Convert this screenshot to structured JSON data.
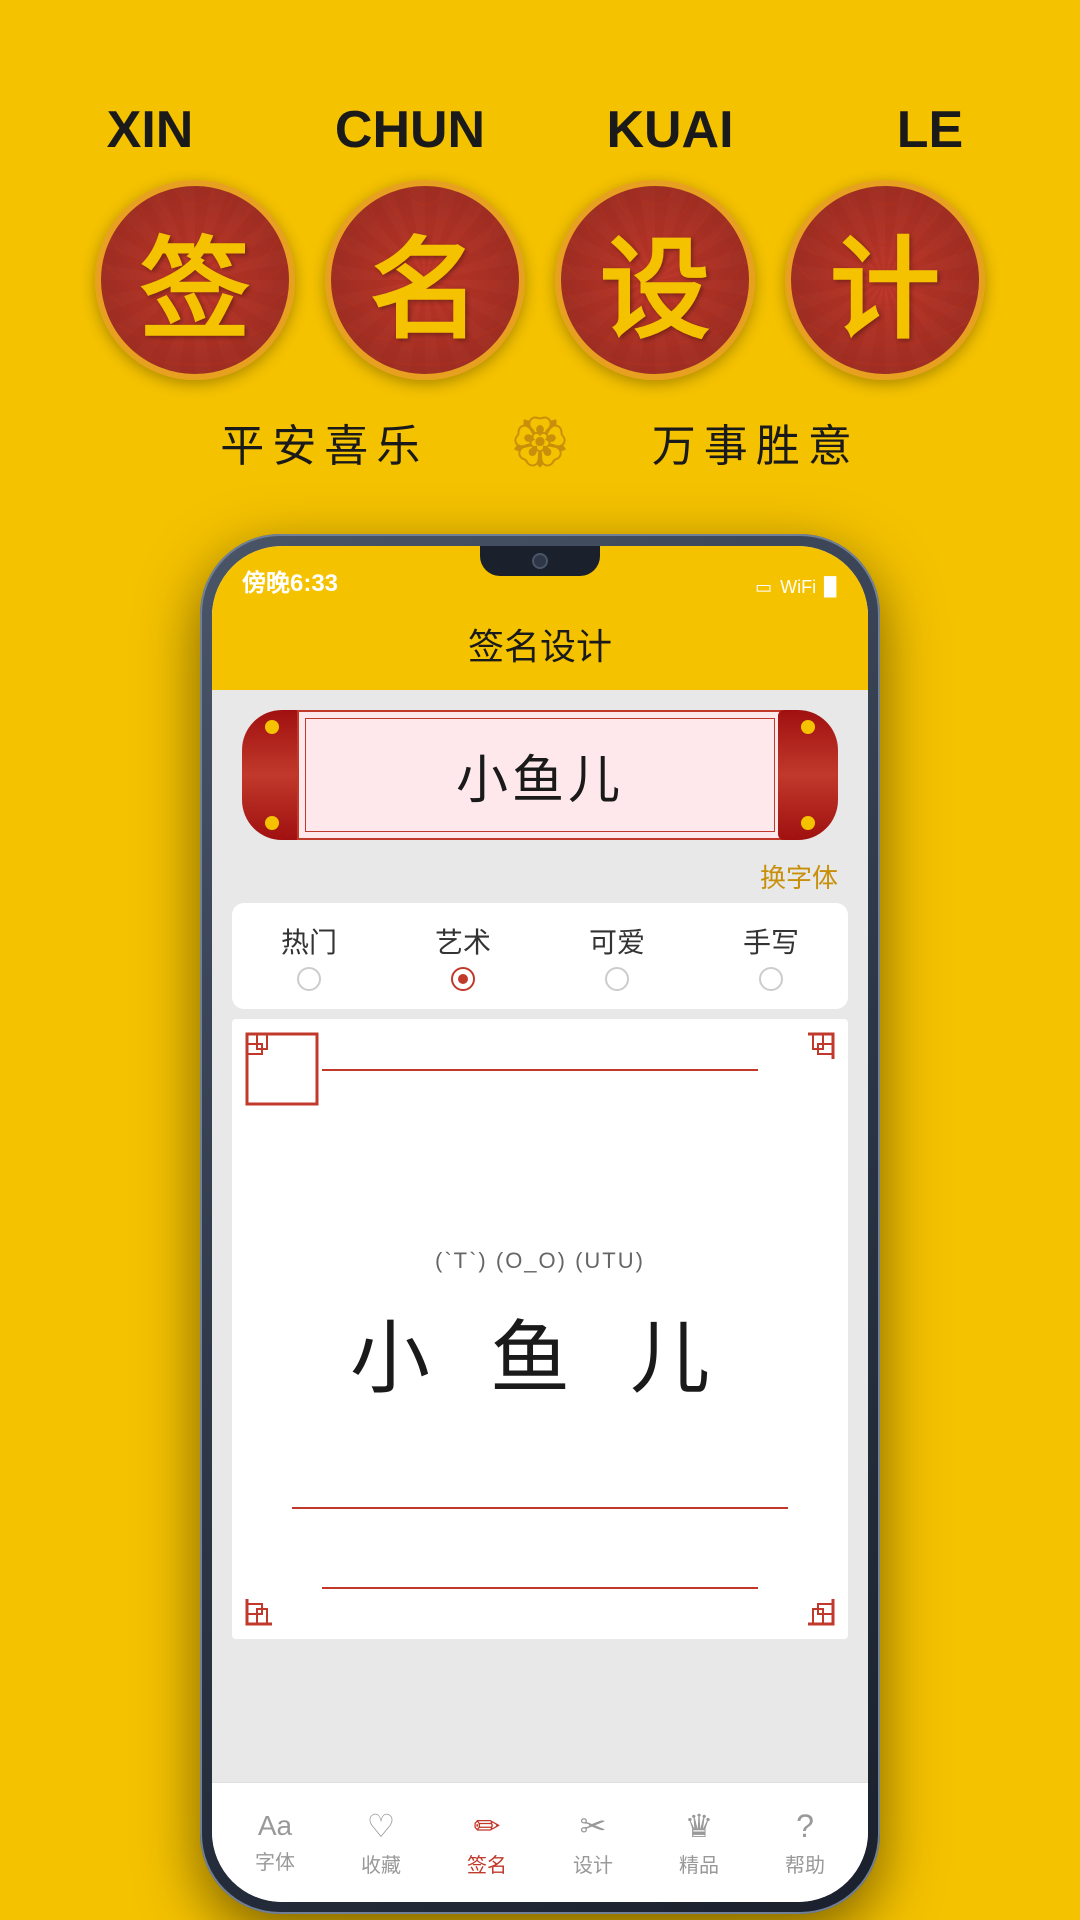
{
  "background_color": "#F5C200",
  "top": {
    "pinyin_labels": [
      "XIN",
      "CHUN",
      "KUAI",
      "LE"
    ],
    "chinese_chars": [
      "签",
      "名",
      "设",
      "计"
    ],
    "subtitle_left": "平安喜乐",
    "subtitle_right": "万事胜意",
    "decoration_icon": "🏮"
  },
  "phone": {
    "status_time": "傍晚6:33",
    "app_title": "签名设计",
    "scroll_name": "小鱼儿",
    "change_font_btn": "换字体",
    "font_tabs": [
      {
        "label": "热门",
        "active": false
      },
      {
        "label": "艺术",
        "active": true
      },
      {
        "label": "可爱",
        "active": false
      },
      {
        "label": "手写",
        "active": false
      }
    ],
    "signature_emotion": "(`T`) (O_O) (UTU)",
    "signature_chars": "小 鱼 儿",
    "nav_items": [
      {
        "label": "字体",
        "icon": "Aa",
        "active": false
      },
      {
        "label": "收藏",
        "icon": "♡",
        "active": false
      },
      {
        "label": "签名",
        "icon": "✏",
        "active": true
      },
      {
        "label": "设计",
        "icon": "✂",
        "active": false
      },
      {
        "label": "精品",
        "icon": "♛",
        "active": false
      },
      {
        "label": "帮助",
        "icon": "?",
        "active": false
      }
    ]
  }
}
